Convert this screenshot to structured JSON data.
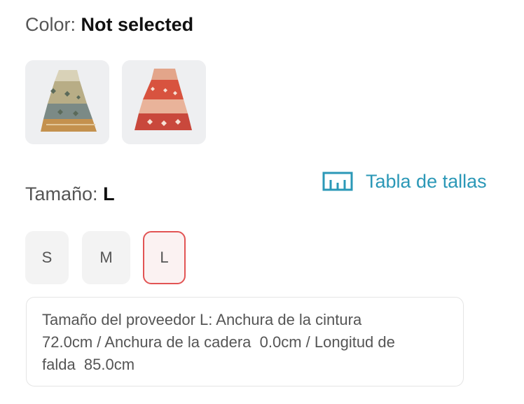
{
  "color": {
    "label": "Color: ",
    "value": "Not selected",
    "options": [
      {
        "name": "floral-multicolor-skirt",
        "colors": [
          "#8a8f6a",
          "#c9b98a",
          "#6c7a8a",
          "#b27a4a"
        ]
      },
      {
        "name": "red-floral-skirt",
        "colors": [
          "#d8533f",
          "#e9a07a",
          "#b8423a",
          "#f1d7c7"
        ]
      }
    ]
  },
  "size": {
    "label": "Tamaño: ",
    "value": "L",
    "options": [
      "S",
      "M",
      "L"
    ],
    "selected": "L"
  },
  "size_chart": {
    "label": "Tabla de tallas",
    "icon": "ruler-icon"
  },
  "size_info": {
    "text": "Tamaño del proveedor L: Anchura de la cintura\n72.0cm / Anchura de la cadera  0.0cm / Longitud de\nfalda  85.0cm"
  },
  "colors": {
    "accent": "#2b98b7",
    "selected_border": "#e25454",
    "option_bg": "#f3f3f3"
  }
}
